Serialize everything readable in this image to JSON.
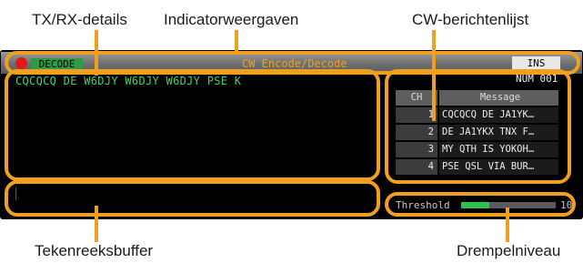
{
  "callouts": {
    "tx_rx_details": "TX/RX-details",
    "indicators": "Indicatorweergaven",
    "cw_message_list": "CW-berichtenlijst",
    "string_buffer": "Tekenreeksbuffer",
    "threshold_level": "Drempelniveau"
  },
  "titlebar": {
    "decode_badge": "DECODE",
    "mode_title": "CW Encode/Decode",
    "ins_label": "INS"
  },
  "rx": {
    "text": "CQCQCQ DE W6DJY W6DJY W6DJY PSE K"
  },
  "message_list": {
    "num_label": "NUM 001",
    "header_ch": "CH",
    "header_message": "Message",
    "rows": [
      {
        "ch": "1",
        "message": "CQCQCQ DE JA1YK…"
      },
      {
        "ch": "2",
        "message": "DE JA1YKX TNX F…"
      },
      {
        "ch": "3",
        "message": "MY QTH IS YOKOH…"
      },
      {
        "ch": "4",
        "message": "PSE QSL VIA BUR…"
      }
    ]
  },
  "threshold": {
    "label": "Threshold",
    "value": "10",
    "level_fraction": 0.3
  },
  "colors": {
    "callout_orange": "#f0a020",
    "decode_green": "#2f9a48",
    "rx_text_green": "#46d26a",
    "record_red": "#e01818"
  }
}
